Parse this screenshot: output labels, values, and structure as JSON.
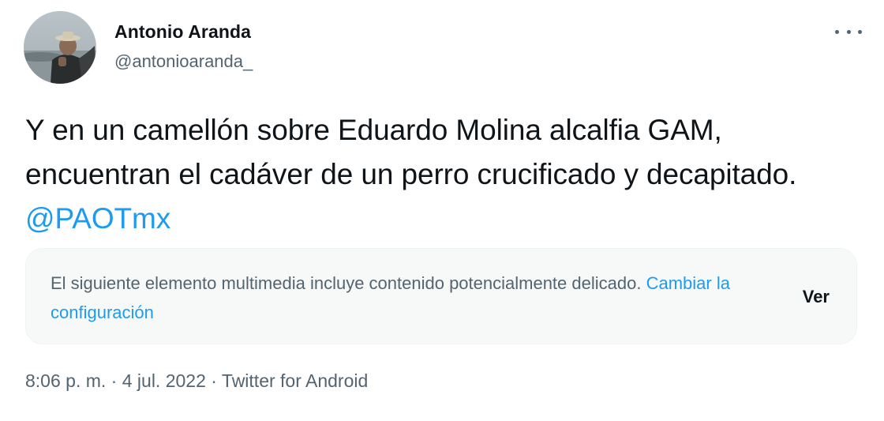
{
  "author": {
    "display_name": "Antonio Aranda",
    "handle": "@antonioaranda_"
  },
  "tweet": {
    "text_part1": "Y en un camellón sobre Eduardo Molina alcalfia GAM, encuentran el cadáver de un perro crucificado y decapitado. ",
    "mention": "@PAOTmx"
  },
  "media_warning": {
    "message": "El siguiente elemento multimedia incluye contenido potencialmente delicado. ",
    "settings_link": "Cambiar la configuración",
    "view_button": "Ver"
  },
  "meta": {
    "time": "8:06 p. m.",
    "separator": "·",
    "date": "4 jul. 2022",
    "source": "Twitter for Android"
  },
  "icons": {
    "more": "more-horizontal-icon",
    "avatar": "user-avatar-photo"
  },
  "colors": {
    "link": "#1d9bf0",
    "secondary_text": "#536471",
    "primary_text": "#0f1419",
    "warning_bg": "#f7f9f9"
  }
}
